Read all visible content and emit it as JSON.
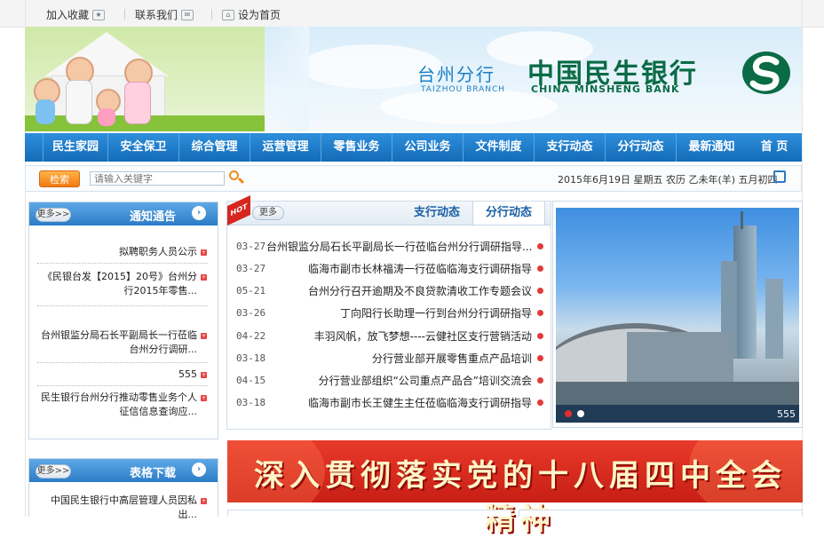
{
  "topbar": {
    "set_homepage": "设为首页",
    "contact_us": "联系我们",
    "add_favorite": "加入收藏"
  },
  "banner": {
    "bank_name_cn": "中国民生银行",
    "bank_name_en": "CHINA MINSHENG BANK",
    "branch_name_cn": "台州分行",
    "branch_name_en": "TAIZHOU BRANCH"
  },
  "nav": {
    "items": [
      "首 页",
      "最新通知",
      "分行动态",
      "支行动态",
      "文件制度",
      "公司业务",
      "零售业务",
      "运营管理",
      "综合管理",
      "安全保卫",
      "民生家园"
    ]
  },
  "search": {
    "button_label": "检索",
    "placeholder": "请输入关键字",
    "date_text": "2015年6月19日 星期五 农历 乙未年(羊) 五月初四"
  },
  "notice_panel": {
    "title": "通知通告",
    "more_label": "更多>>",
    "items": [
      "拟聘职务人员公示",
      "《民银台发【2015】20号》台州分行2015年零售...",
      "台州银监分局石长平副局长一行莅临台州分行调研...",
      "555",
      "民生银行台州分行推动零售业务个人征信信息查询应..."
    ]
  },
  "notice2_panel": {
    "title": "表格下载",
    "more_label": "更多>>",
    "items": [
      "中国民生银行中高层管理人员因私出..."
    ]
  },
  "tabs": {
    "labels": [
      "分行动态",
      "支行动态"
    ],
    "more_label": "更多",
    "hot_label": "HOT"
  },
  "news": [
    {
      "title": "台州银监分局石长平副局长一行莅临台州分行调研指导...",
      "date": "03-27"
    },
    {
      "title": "临海市副市长林福涛一行莅临临海支行调研指导",
      "date": "03-27"
    },
    {
      "title": "台州分行召开逾期及不良贷款清收工作专题会议",
      "date": "05-21"
    },
    {
      "title": "丁向阳行长助理一行到台州分行调研指导",
      "date": "03-26"
    },
    {
      "title": "丰羽风帆，放飞梦想----云健社区支行营销活动",
      "date": "04-22"
    },
    {
      "title": "分行营业部开展零售重点产品培训",
      "date": "03-18"
    },
    {
      "title": "分行营业部组织“公司重点产品合”培训交流会",
      "date": "04-15"
    },
    {
      "title": "临海市副市长王健生主任莅临临海支行调研指导",
      "date": "03-18"
    }
  ],
  "photo": {
    "caption": "555"
  },
  "red_banner": {
    "text": "深入贯彻落实党的十八届四中全会精神"
  }
}
